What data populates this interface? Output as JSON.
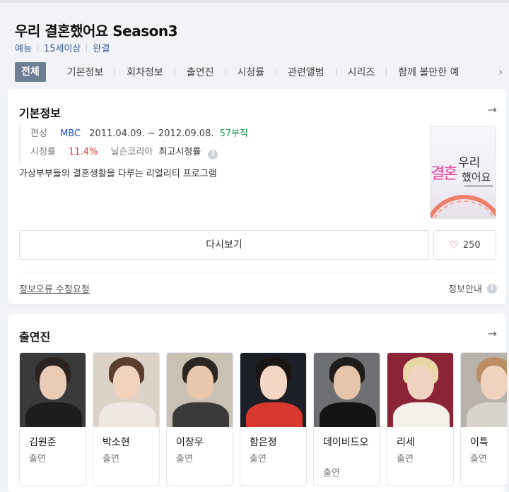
{
  "header": {
    "title": "우리 결혼했어요 Season3",
    "meta": [
      "예능",
      "15세이상",
      "완결"
    ],
    "tabs": [
      "전체",
      "기본정보",
      "회차정보",
      "출연진",
      "시청률",
      "관련앨범",
      "시리즈",
      "함께 볼만한 예"
    ]
  },
  "basic_info": {
    "section_title": "기본정보",
    "broadcast_label": "편성",
    "channel": "MBC",
    "period": "2011.04.09. ~ 2012.09.08.",
    "episodes": "57부작",
    "rating_label": "시청률",
    "rating_value": "11.4%",
    "rating_source": "닐슨코리아",
    "rating_note": "최고시청률",
    "description": "가상부부들의 결혼생활을 다루는 리얼리티 프로그램",
    "poster_text": [
      "우리",
      "결혼",
      "했어요"
    ],
    "replay_label": "다시보기",
    "like_count": "250",
    "report_label": "정보오류 수정요청",
    "info_guide_label": "정보안내"
  },
  "cast_section": {
    "section_title": "출연진",
    "members": [
      {
        "name": "김원준",
        "role": "출연",
        "bg": "#3a3a3a",
        "skin": "#e9cbb6",
        "hair": "#2a2320",
        "cloth": "#1d1d1d"
      },
      {
        "name": "박소현",
        "role": "출연",
        "bg": "#ddd2c8",
        "skin": "#f0d2bd",
        "hair": "#5a3f2e",
        "cloth": "#efe8e2"
      },
      {
        "name": "이장우",
        "role": "출연",
        "bg": "#c9c2b4",
        "skin": "#e8c7ad",
        "hair": "#2b2622",
        "cloth": "#3b3a38"
      },
      {
        "name": "함은정",
        "role": "출연",
        "bg": "#1c1f26",
        "skin": "#f3d6c4",
        "hair": "#1a1413",
        "cloth": "#d8382e"
      },
      {
        "name": "데이비드오",
        "role": "출연",
        "bg": "#6e6f73",
        "skin": "#e6c4a9",
        "hair": "#1f1c1c",
        "cloth": "#141414"
      },
      {
        "name": "리세",
        "role": "출연",
        "bg": "#8c2437",
        "skin": "#f1d3c2",
        "hair": "#e9d7a8",
        "cloth": "#f4f1ea"
      },
      {
        "name": "이특",
        "role": "출연",
        "bg": "#b9b2aa",
        "skin": "#f0d3bf",
        "hair": "#b98e65",
        "cloth": "#d9d3cd"
      }
    ]
  },
  "colors": {
    "accent_tab": "#6e7c94",
    "channel_link": "#1a4fb5",
    "episodes": "#16a34a",
    "rating": "#e13c3c"
  },
  "icons": {
    "arrow": "arrow-right-icon",
    "info": "info-icon",
    "heart": "heart-icon",
    "tab_next": "chevron-right-icon"
  }
}
